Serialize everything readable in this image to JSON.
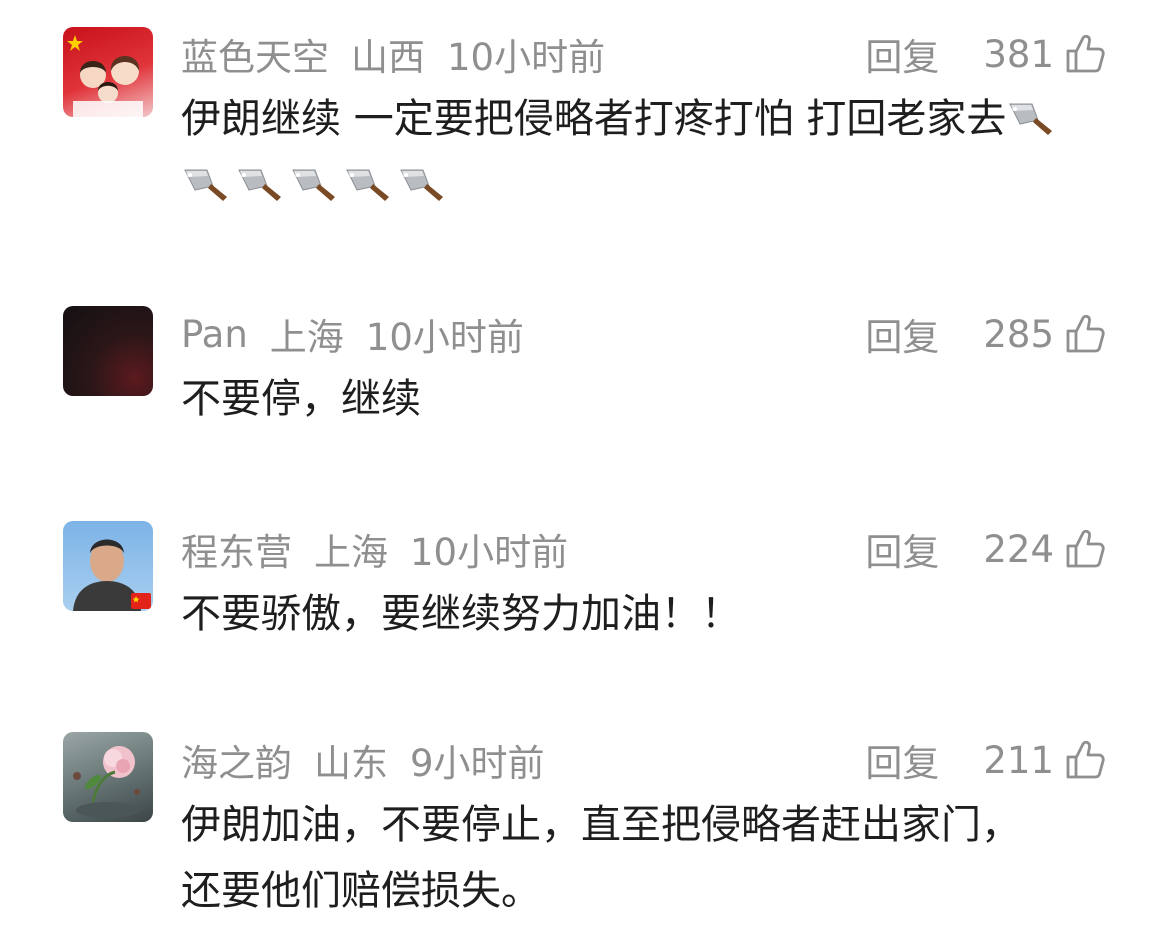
{
  "comments": [
    {
      "username": "蓝色天空",
      "location": "山西",
      "time": "10小时前",
      "reply_label": "回复",
      "likes": "381",
      "avatar_icon": "family-cartoon-avatar",
      "text": "伊朗继续  一定要把侵略者打疼打怕  打回老家去",
      "emoji": "kitchen-knife-emoji",
      "emoji_count": 6
    },
    {
      "username": "Pan",
      "location": "上海",
      "time": "10小时前",
      "reply_label": "回复",
      "likes": "285",
      "avatar_icon": "dark-photo-avatar",
      "text": "不要停，继续"
    },
    {
      "username": "程东营",
      "location": "上海",
      "time": "10小时前",
      "reply_label": "回复",
      "likes": "224",
      "avatar_icon": "portrait-photo-avatar",
      "text": "不要骄傲，要继续努力加油！！"
    },
    {
      "username": "海之韵",
      "location": "山东",
      "time": "9小时前",
      "reply_label": "回复",
      "likes": "211",
      "avatar_icon": "flower-painting-avatar",
      "text": "伊朗加油，不要停止，直至把侵略者赶出家门，还要他们赔偿损失。"
    }
  ]
}
